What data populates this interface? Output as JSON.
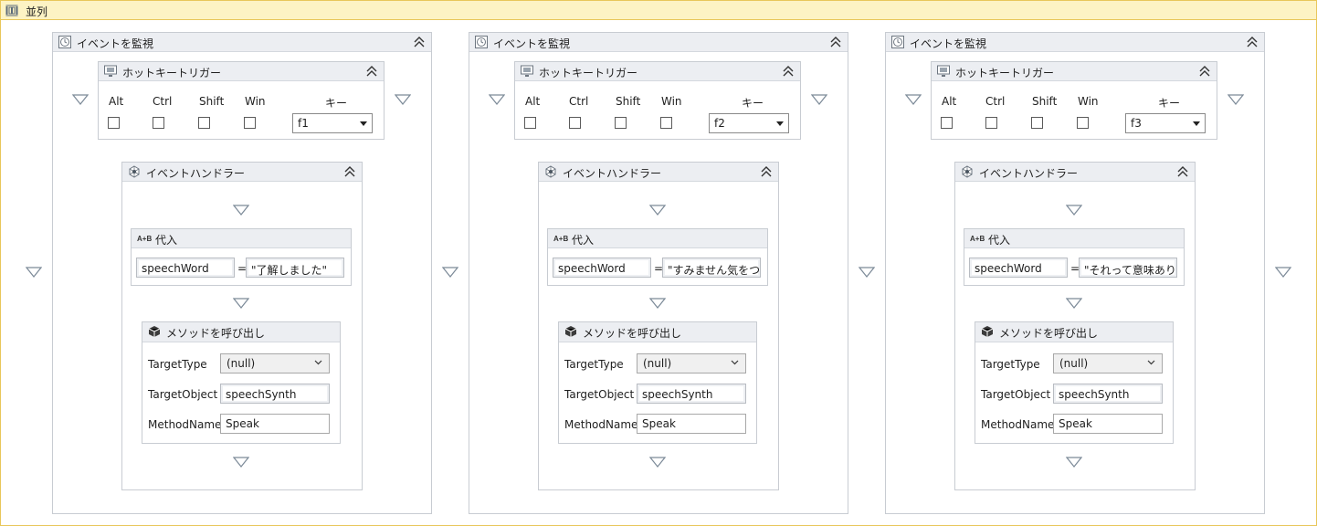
{
  "parallel": {
    "title": "並列"
  },
  "columns": [
    {
      "monitor_title": "イベントを監視",
      "trigger_title": "ホットキートリガー",
      "modifiers": [
        "Alt",
        "Ctrl",
        "Shift",
        "Win"
      ],
      "key_label": "キー",
      "key_value": "f1",
      "handler_title": "イベントハンドラー",
      "assign_title": "代入",
      "assign_to": "speechWord",
      "assign_value": "\"了解しました\"",
      "invoke_title": "メソッドを呼び出し",
      "target_type_label": "TargetType",
      "target_type_value": "(null)",
      "target_object_label": "TargetObject",
      "target_object_value": "speechSynth",
      "method_name_label": "MethodName",
      "method_name_value": "Speak"
    },
    {
      "monitor_title": "イベントを監視",
      "trigger_title": "ホットキートリガー",
      "modifiers": [
        "Alt",
        "Ctrl",
        "Shift",
        "Win"
      ],
      "key_label": "キー",
      "key_value": "f2",
      "handler_title": "イベントハンドラー",
      "assign_title": "代入",
      "assign_to": "speechWord",
      "assign_value": "\"すみません気をつけ",
      "invoke_title": "メソッドを呼び出し",
      "target_type_label": "TargetType",
      "target_type_value": "(null)",
      "target_object_label": "TargetObject",
      "target_object_value": "speechSynth",
      "method_name_label": "MethodName",
      "method_name_value": "Speak"
    },
    {
      "monitor_title": "イベントを監視",
      "trigger_title": "ホットキートリガー",
      "modifiers": [
        "Alt",
        "Ctrl",
        "Shift",
        "Win"
      ],
      "key_label": "キー",
      "key_value": "f3",
      "handler_title": "イベントハンドラー",
      "assign_title": "代入",
      "assign_to": "speechWord",
      "assign_value": "\"それって意味ありま",
      "invoke_title": "メソッドを呼び出し",
      "target_type_label": "TargetType",
      "target_type_value": "(null)",
      "target_object_label": "TargetObject",
      "target_object_value": "speechSynth",
      "method_name_label": "MethodName",
      "method_name_value": "Speak"
    }
  ],
  "icons": {
    "parallel": "parallel-icon",
    "monitor": "clock-icon",
    "trigger": "monitor-icon",
    "handler": "handler-icon",
    "assign": "assign-icon",
    "invoke": "invoke-method-icon",
    "collapse": "collapse-chevron-icon",
    "drop": "drop-target-icon"
  },
  "colors": {
    "parallel_border": "#e8c75a",
    "parallel_header": "#fdf3c4",
    "box_header": "#eceef2",
    "box_border": "#c8ccd2"
  }
}
